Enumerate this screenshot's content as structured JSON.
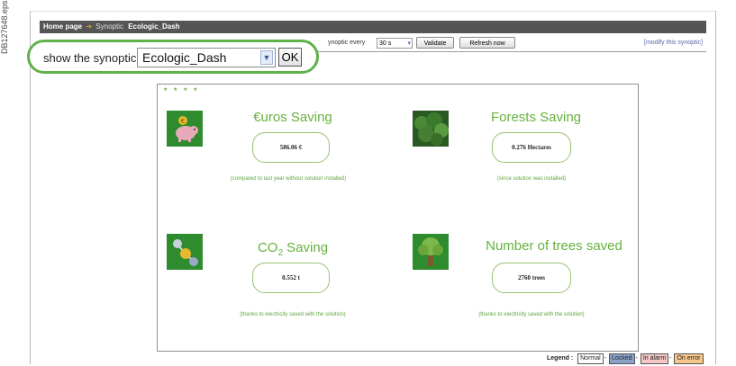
{
  "side_label": "DB127648.eps",
  "breadcrumb": {
    "home": "Home page",
    "arrow": "➜",
    "section": "Synoptic",
    "current": "Ecologic_Dash"
  },
  "controls": {
    "show_label": "show the synoptic",
    "synoptic_value": "Ecologic_Dash",
    "ok_label": "OK",
    "every_label": "ynoptic every",
    "every_value": "30 s",
    "validate_label": "Validate",
    "refresh_label": "Refresh now",
    "modify_link": "[modify this synoptic]"
  },
  "panel_tools": "★ ★ ★ ★",
  "tiles": [
    {
      "title": "€uros Saving",
      "value": "586.06 €",
      "note": "(compared to last year without solution installed)",
      "icon": "piggy-bank-icon"
    },
    {
      "title": "Forests Saving",
      "value": "0.276 Hectares",
      "note": "(since solution was installed)",
      "icon": "forest-icon"
    },
    {
      "title_prefix": "CO",
      "title_sub": "2",
      "title_suffix": " Saving",
      "value": "0.552 t",
      "note": "(thanks to electricity saved with the solution)",
      "icon": "molecule-icon"
    },
    {
      "title": "Number of trees saved",
      "value": "2760 trees",
      "note": "(thanks to electricity saved with the solution)",
      "icon": "tree-icon"
    }
  ],
  "legend": {
    "label": "Legend :",
    "items": [
      {
        "label": "Normal",
        "color": "#ffffff"
      },
      {
        "label": "Locked",
        "color": "#8aa2c8"
      },
      {
        "label": "In alarm",
        "color": "#f4c6c6"
      },
      {
        "label": "On error",
        "color": "#f6c98a"
      }
    ]
  },
  "colors": {
    "accent_green": "#66b13f",
    "highlight_ring": "#61b04a",
    "topbar": "#555555"
  }
}
